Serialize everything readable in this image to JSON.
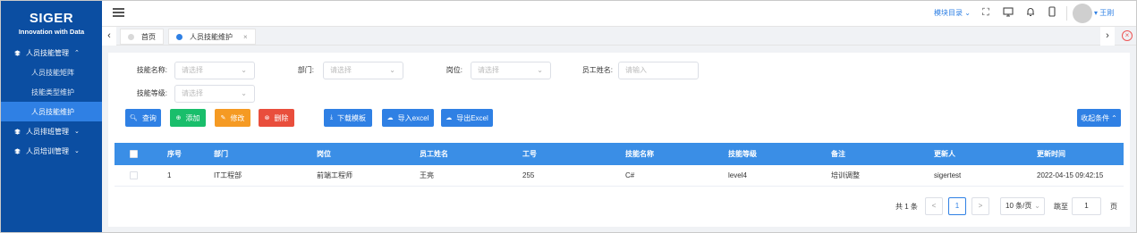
{
  "brand": {
    "name": "SIGER",
    "tagline": "Innovation with Data"
  },
  "sidebar": {
    "groups": [
      {
        "label": "人员技能管理",
        "chevron": "^",
        "children": [
          {
            "label": "人员技能矩阵",
            "active": false
          },
          {
            "label": "技能类型维护",
            "active": false
          },
          {
            "label": "人员技能维护",
            "active": true
          }
        ]
      },
      {
        "label": "人员排班管理",
        "chevron": "v"
      },
      {
        "label": "人员培训管理",
        "chevron": "v"
      }
    ]
  },
  "header": {
    "module_menu": "模块目录",
    "user_name": "王刚"
  },
  "tabs": [
    {
      "label": "首页",
      "dot_color": "#d9d9d9"
    },
    {
      "label": "人员技能维护",
      "dot_color": "#2f80e4",
      "close": "×"
    }
  ],
  "filters": {
    "skill_name": {
      "label": "技能名称:",
      "placeholder": "请选择"
    },
    "department": {
      "label": "部门:",
      "placeholder": "请选择"
    },
    "position": {
      "label": "岗位:",
      "placeholder": "请选择"
    },
    "employee_name": {
      "label": "员工姓名:",
      "placeholder": "请输入"
    },
    "skill_level": {
      "label": "技能等级:",
      "placeholder": "请选择"
    }
  },
  "actions": {
    "query": "查询",
    "add": "添加",
    "edit": "修改",
    "delete": "删除",
    "download_template": "下载模板",
    "import_excel": "导入excel",
    "export_excel": "导出Excel",
    "collapse": "收起条件"
  },
  "colors": {
    "primary": "#2f80e4",
    "success": "#19be6b",
    "warning": "#f59a23",
    "danger": "#e94e3c",
    "sidebar": "#0b4ea2"
  },
  "table": {
    "columns": [
      "序号",
      "部门",
      "岗位",
      "员工姓名",
      "工号",
      "技能名称",
      "技能等级",
      "备注",
      "更新人",
      "更新时间"
    ],
    "rows": [
      [
        "1",
        "IT工程部",
        "前端工程师",
        "王亮",
        "255",
        "C#",
        "level4",
        "培训调整",
        "sigertest",
        "2022-04-15 09:42:15"
      ]
    ]
  },
  "pagination": {
    "total": "共 1 条",
    "prev": "<",
    "page": "1",
    "next": ">",
    "page_size": "10 条/页",
    "goto": "跳至",
    "goto_value": "1",
    "page_unit": "页"
  }
}
